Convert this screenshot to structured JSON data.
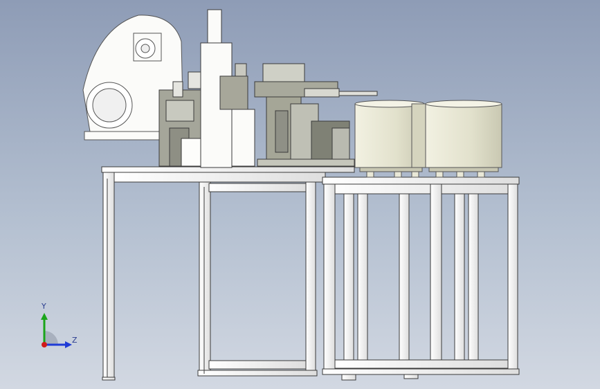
{
  "viewport": {
    "background_top": "#8e9cb6",
    "background_bottom": "#d2d8e2"
  },
  "colors": {
    "frame_fill": "#f4f5f3",
    "frame_stroke": "#3a3a3a",
    "machine_metal": "#a7a79a",
    "bowl_fill": "#e8e7d6",
    "bowl_shade": "#c8c7b2"
  },
  "triad": {
    "y_label": "Y",
    "z_label": "Z",
    "y_color": "#1aa51a",
    "z_color": "#1f3bd6",
    "origin_color": "#d11b1b",
    "icon": "coordinate-triad-icon"
  }
}
